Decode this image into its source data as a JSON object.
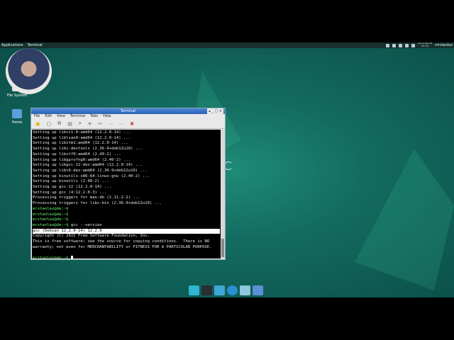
{
  "panel": {
    "applications": "Applications",
    "task": "Terminal",
    "date": "2025-06-09",
    "time": "02:33",
    "user": "mrstanlez"
  },
  "desktop": {
    "icons": [
      {
        "label": "File System"
      },
      {
        "label": "Home"
      }
    ]
  },
  "terminal": {
    "title": "Terminal",
    "controls": "▴ _ □ ×",
    "menu": [
      "File",
      "Edit",
      "View",
      "Terminal",
      "Tabs",
      "Help"
    ],
    "toolbar": [
      "▣",
      "▢",
      "⧉",
      "▤",
      "⌕",
      "✛",
      "✂",
      "⇦",
      "⇨",
      "✖"
    ],
    "lines": [
      "Setting up libcc1-0:amd64 (12.2.0-14) ...",
      "Setting up liblsan0:amd64 (12.2.0-14) ...",
      "Setting up libitm1:amd64 (12.2.0-14) ...",
      "Setting up libc-devtools (2.36-9+deb12u10) ...",
      "Setting up libctf0:amd64 (2.40-2) ...",
      "Setting up libgprofng0:amd64 (2.40-2) ...",
      "Setting up libgcc-12-dev:amd64 (12.2.0-14) ...",
      "Setting up libc6-dev:amd64 (2.36-9+deb12u10) ...",
      "Setting up binutils-x86-64-linux-gnu (2.40-2) ...",
      "Setting up binutils (2.40-2) ...",
      "Setting up gcc-12 (12.2.0-14) ...",
      "Setting up gcc (4:12.2.0-3) ...",
      "Processing triggers for man-db (2.11.2-2) ...",
      "Processing triggers for libc-bin (2.36-9+deb12u10) ..."
    ],
    "prompt": "mrstanlez@de:~$",
    "command": " gcc --version",
    "output_highlight": "gcc (Debian 12.2.0-14) 12.2.0",
    "output": [
      "Copyright (C) 2022 Free Software Foundation, Inc.",
      "This is free software; see the source for copying conditions.  There is NO",
      "warranty; not even for MERCHANTABILITY or FITNESS FOR A PARTICULAR PURPOSE.",
      ""
    ]
  },
  "dock": {
    "colors": [
      "#2fb5d0",
      "#2a2f33",
      "#3fa7d6",
      "#2b8fd0",
      "#8fc7de",
      "#5b8fd6"
    ]
  }
}
